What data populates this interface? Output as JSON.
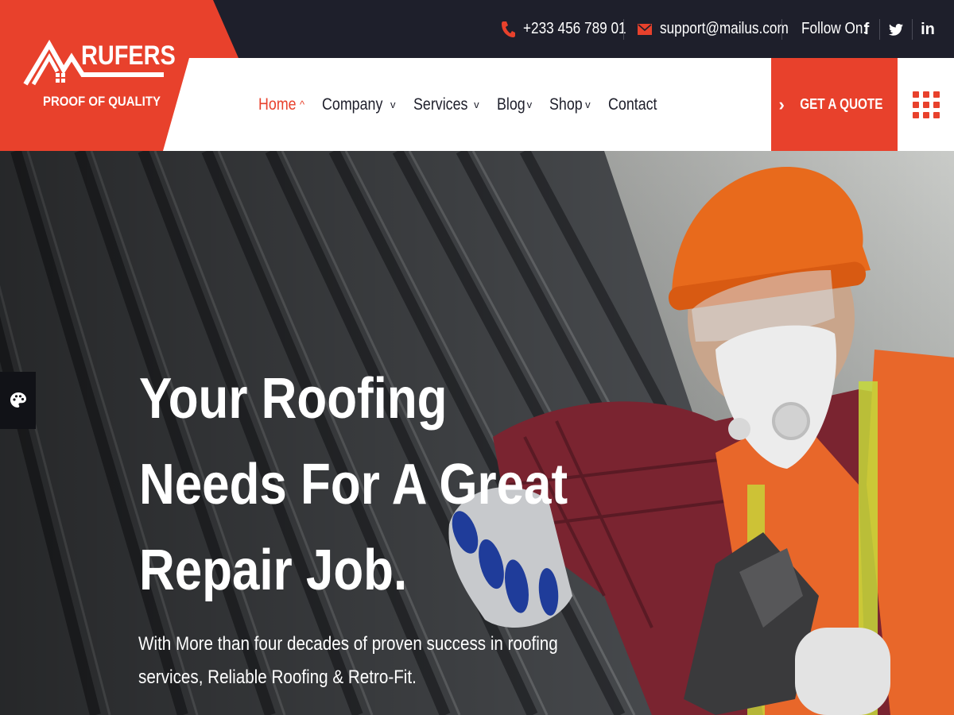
{
  "brand": {
    "name": "RUFERS",
    "tagline": "PROOF OF QUALITY"
  },
  "topbar": {
    "phone": "+233 456 789 01",
    "email": "support@mailus.com",
    "follow_label": "Follow On:",
    "social": [
      {
        "icon": "facebook-icon",
        "glyph": "f"
      },
      {
        "icon": "twitter-icon",
        "glyph": "🐦"
      },
      {
        "icon": "linkedin-icon",
        "glyph": "in"
      }
    ]
  },
  "nav": {
    "items": [
      {
        "label": "Home",
        "chevron": "^",
        "active": true
      },
      {
        "label": "Company",
        "chevron": "v"
      },
      {
        "label": "Services",
        "chevron": "v"
      },
      {
        "label": "Blog",
        "chevron": "v"
      },
      {
        "label": "Shop",
        "chevron": "v"
      },
      {
        "label": "Contact"
      }
    ],
    "quote_label": "GET A QUOTE",
    "quote_arrow": "›"
  },
  "hero": {
    "title_lines": [
      "Your Roofing",
      "Needs For A Great",
      "Repair Job."
    ],
    "subtitle_lines": [
      "With More than four decades of proven success in roofing",
      "services, Reliable Roofing & Retro-Fit."
    ]
  },
  "colors": {
    "accent": "#e8412c",
    "dark": "#1e1f2b",
    "white": "#ffffff"
  },
  "icons": {
    "phone": "phone-icon",
    "email": "mail-icon",
    "menu_grid": "grid-menu-icon",
    "palette": "palette-icon"
  }
}
